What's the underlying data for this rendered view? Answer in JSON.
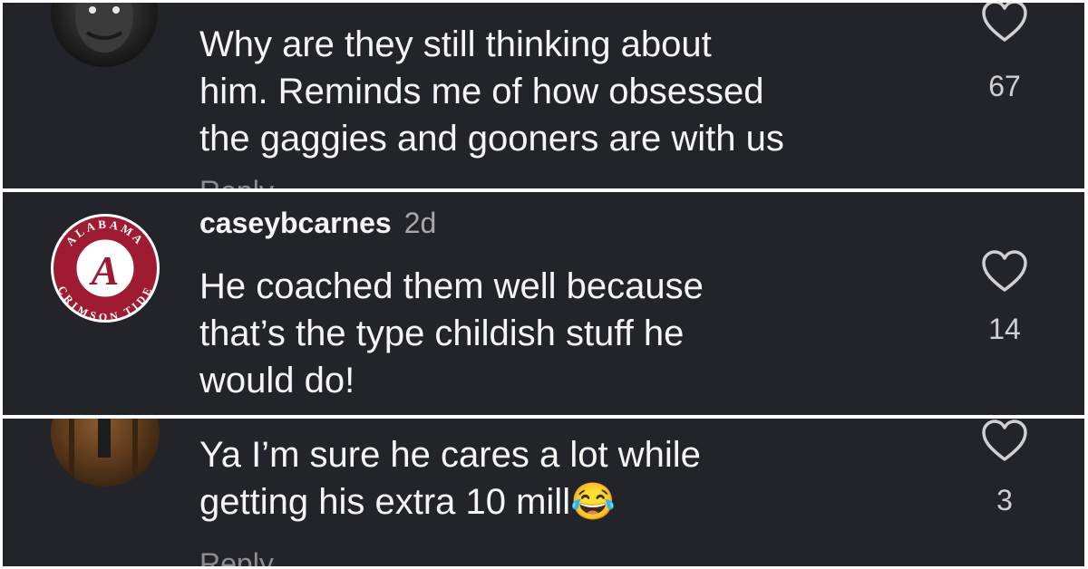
{
  "comments": [
    {
      "username": "",
      "time": "",
      "text": "Why are they still thinking about\nhim. Reminds me of how obsessed\nthe gaggies and gooners are with us",
      "reply_label": "Reply",
      "likes": "67",
      "avatar_icon": "dark-face-avatar"
    },
    {
      "username": "caseybcarnes",
      "time": "2d",
      "text": "He coached them well because\nthat’s the type childish stuff he\nwould do!",
      "reply_label": "",
      "likes": "14",
      "avatar_icon": "alabama-logo-avatar",
      "logo": {
        "letter": "A",
        "ring_top": "ALABAMA",
        "ring_bottom": "CRIMSON TIDE"
      }
    },
    {
      "username": "",
      "time": "",
      "text": "Ya I’m sure he cares a lot while\ngetting his extra 10 mill",
      "emoji": "😂",
      "reply_label": "Reply",
      "likes": "3",
      "avatar_icon": "warehouse-photo-avatar"
    }
  ],
  "colors": {
    "background": "#23242a",
    "text": "#f5f5f5",
    "muted": "#a8a8a8",
    "crimson": "#9e1b32"
  },
  "icons": {
    "like": "heart-outline-icon"
  }
}
